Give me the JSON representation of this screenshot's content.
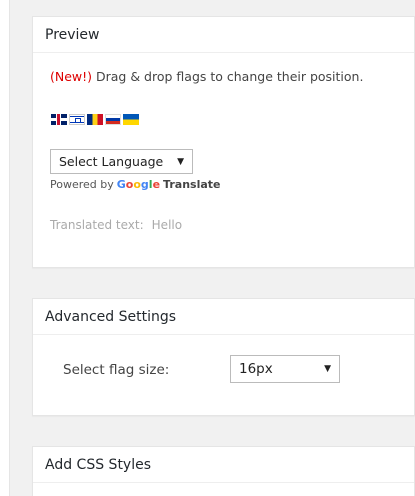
{
  "preview": {
    "title": "Preview",
    "notice_new": "(New!)",
    "notice_text": " Drag & drop flags to change their position.",
    "flags": [
      {
        "icon": "uk-flag-icon"
      },
      {
        "icon": "israel-flag-icon"
      },
      {
        "icon": "romania-flag-icon"
      },
      {
        "icon": "russia-flag-icon"
      },
      {
        "icon": "ukraine-flag-icon"
      }
    ],
    "language_select_value": "Select Language",
    "powered_by": "Powered by",
    "google_letters": [
      "G",
      "o",
      "o",
      "g",
      "l",
      "e"
    ],
    "google_colors": [
      "#4285f4",
      "#ea4335",
      "#fbbc05",
      "#4285f4",
      "#34a853",
      "#ea4335"
    ],
    "translate_label": "Translate",
    "translated_label": "Translated text:",
    "translated_value": "Hello"
  },
  "advanced": {
    "title": "Advanced Settings",
    "flag_size_label": "Select flag size:",
    "flag_size_value": "16px"
  },
  "css_styles": {
    "title": "Add CSS Styles"
  }
}
